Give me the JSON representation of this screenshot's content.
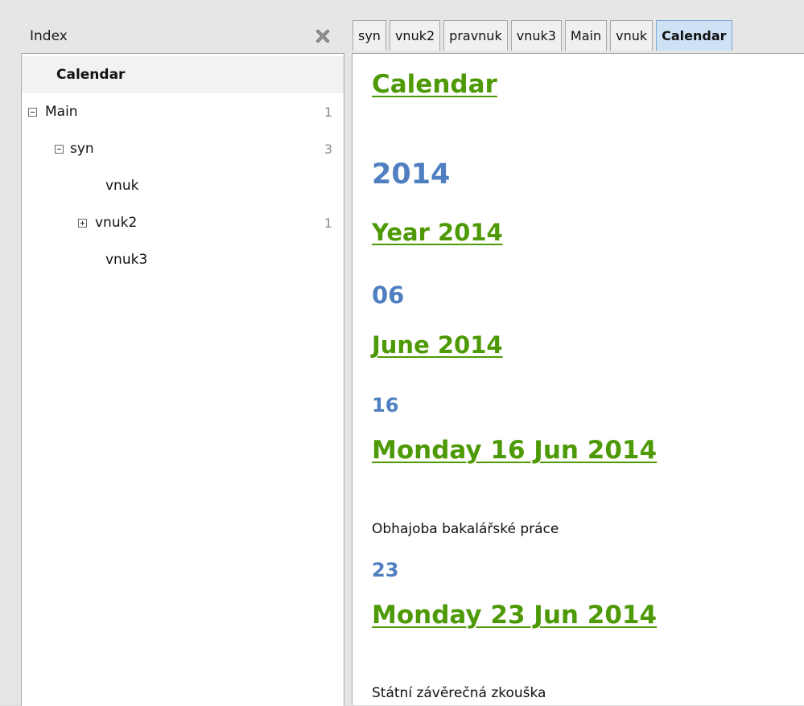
{
  "index": {
    "title": "Index",
    "close_icon": "close-x-icon",
    "tree": [
      {
        "id": "calendar",
        "label": "Calendar",
        "count": "",
        "toggle": "none",
        "selected": true
      },
      {
        "id": "main",
        "label": "Main",
        "count": "1",
        "toggle": "expanded"
      },
      {
        "id": "syn",
        "label": "syn",
        "count": "3",
        "toggle": "expanded"
      },
      {
        "id": "vnuk",
        "label": "vnuk",
        "count": "",
        "toggle": "none"
      },
      {
        "id": "vnuk2",
        "label": "vnuk2",
        "count": "1",
        "toggle": "collapsed"
      },
      {
        "id": "vnuk3",
        "label": "vnuk3",
        "count": "",
        "toggle": "none"
      }
    ]
  },
  "tabs": [
    {
      "label": "syn",
      "active": false
    },
    {
      "label": "vnuk2",
      "active": false
    },
    {
      "label": "pravnuk",
      "active": false
    },
    {
      "label": "vnuk3",
      "active": false
    },
    {
      "label": "Main",
      "active": false
    },
    {
      "label": "vnuk",
      "active": false
    },
    {
      "label": "Calendar",
      "active": true
    }
  ],
  "page": {
    "title_link": "Calendar",
    "year_heading": "2014",
    "year_link": "Year 2014",
    "month_heading": "06",
    "month_link": "June 2014",
    "day1_heading": "16",
    "day1_link": "Monday 16 Jun 2014",
    "day1_text": "Obhajoba bakalářské práce",
    "day2_heading": "23",
    "day2_link": "Monday 23 Jun 2014",
    "day2_text": "Státní závěrečná zkouška"
  },
  "colors": {
    "link_green": "#4e9a06",
    "heading_blue": "#4f7fc0",
    "active_tab": "#cfe2f5"
  }
}
